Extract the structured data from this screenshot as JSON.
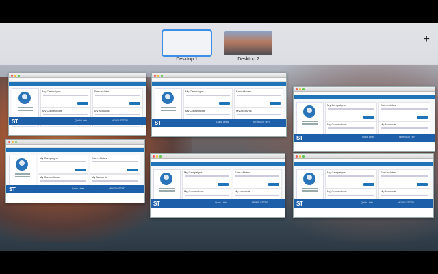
{
  "spaces": [
    {
      "label": "Desktop 1"
    },
    {
      "label": "Desktop 2"
    }
  ],
  "add_space": {
    "label": "+"
  },
  "window": {
    "sections": [
      {
        "title": "My Campaigns"
      },
      {
        "title": "Earn eNotes"
      },
      {
        "title": "My Connections"
      },
      {
        "title": "My Accounts"
      }
    ],
    "footer": {
      "logo": "ST",
      "col1": "Quick Links",
      "col2": "NEWSLETTER"
    }
  },
  "dock": {
    "items": [
      {
        "name": "finder-icon",
        "glyph": "☻",
        "color": "#2e8be6"
      },
      {
        "name": "facetime-icon",
        "glyph": "◉",
        "color": "#39b54a"
      },
      {
        "name": "launchpad-icon",
        "glyph": "✈",
        "color": "#4b4f57"
      },
      {
        "name": "preview-icon",
        "glyph": "▣",
        "color": "#4a7fc4"
      },
      {
        "name": "notes-icon",
        "glyph": "≡",
        "color": "#a57b45"
      },
      {
        "name": "photos-icon",
        "glyph": "✿",
        "color": "#e8e8ea"
      },
      {
        "name": "system-preferences-icon",
        "glyph": "⚙",
        "color": "#6a6f76"
      },
      {
        "name": "itunes-icon",
        "glyph": "♫",
        "color": "#e6e6ea"
      },
      {
        "name": "messenger-icon",
        "glyph": "✉",
        "color": "#2b90f0"
      },
      {
        "name": "chrome-icon",
        "glyph": "◎",
        "color": "#d94a3a"
      },
      {
        "name": "documents-icon",
        "glyph": "▤",
        "color": "#dcdde2"
      },
      {
        "name": "trash-icon",
        "glyph": "▥",
        "color": "#c9cbd0"
      }
    ]
  }
}
